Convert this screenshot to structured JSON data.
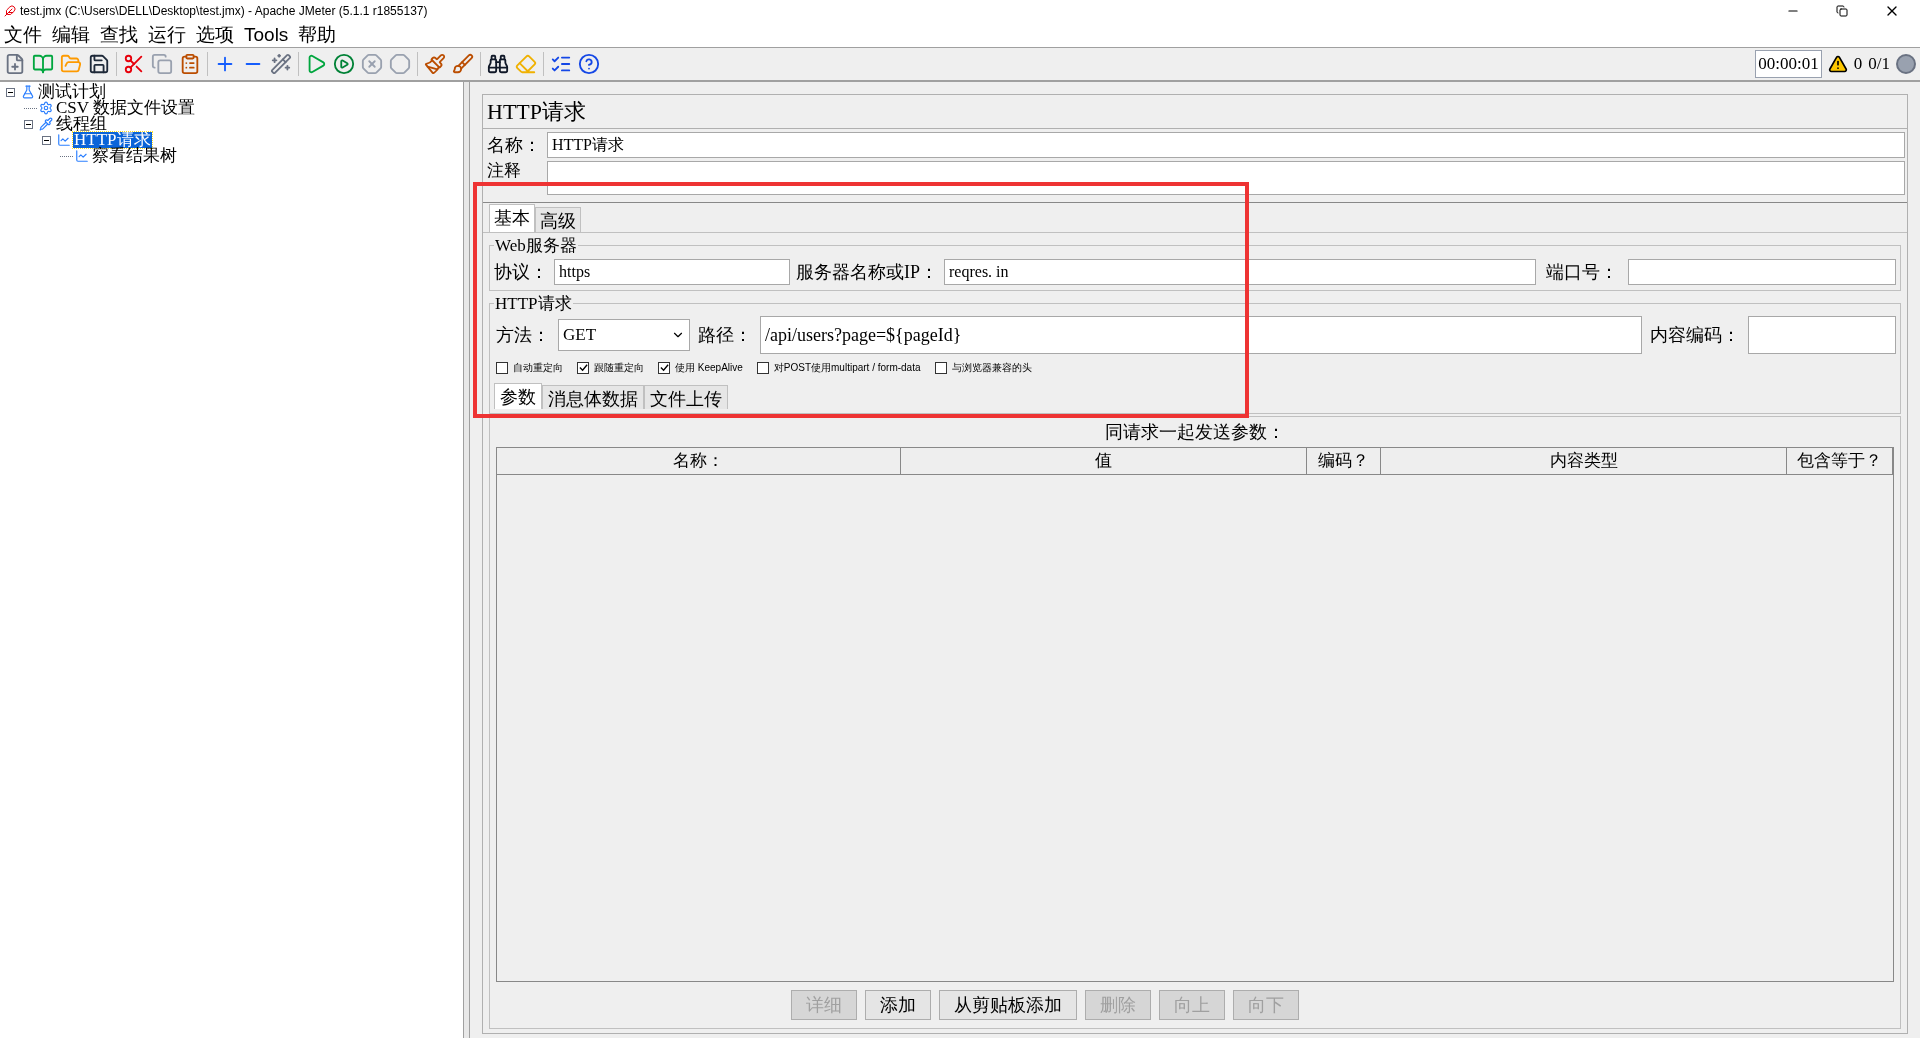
{
  "window": {
    "title": "test.jmx (C:\\Users\\DELL\\Desktop\\test.jmx) - Apache JMeter (5.1.1 r1855137)"
  },
  "menu": [
    "文件",
    "编辑",
    "查找",
    "运行",
    "选项",
    "Tools",
    "帮助"
  ],
  "status": {
    "timer": "00:00:01",
    "warnings": "0",
    "threads": "0/1"
  },
  "tree": [
    {
      "label": "测试计划",
      "selected": false,
      "expanded": true,
      "children": [
        {
          "label": "CSV 数据文件设置",
          "selected": false
        },
        {
          "label": "线程组",
          "selected": false,
          "expanded": true,
          "children": [
            {
              "label": "HTTP请求",
              "selected": true,
              "expanded": true,
              "children": [
                {
                  "label": "察看结果树",
                  "selected": false
                }
              ]
            }
          ]
        }
      ]
    }
  ],
  "panel": {
    "title": "HTTP请求",
    "name_label": "名称：",
    "name_value": "HTTP请求",
    "comment_label": "注释",
    "tabs": [
      {
        "label": "基本",
        "selected": true
      },
      {
        "label": "高级",
        "selected": false
      }
    ],
    "web_server": {
      "legend": "Web服务器",
      "protocol_label": "协议：",
      "protocol": "https",
      "server_label": "服务器名称或IP：",
      "server": "reqres. in",
      "port_label": "端口号："
    },
    "http_request": {
      "legend": "HTTP请求",
      "method_label": "方法：",
      "method": "GET",
      "path_label": "路径：",
      "path": "/api/users?page=${pageId}",
      "encoding_label": "内容编码："
    },
    "checkboxes": [
      {
        "label": "自动重定向",
        "checked": false
      },
      {
        "label": "跟随重定向",
        "checked": true
      },
      {
        "label": "使用 KeepAlive",
        "checked": true
      },
      {
        "label": "对POST使用multipart / form-data",
        "checked": false
      },
      {
        "label": "与浏览器兼容的头",
        "checked": false
      }
    ],
    "sub_tabs": [
      {
        "label": "参数",
        "selected": true
      },
      {
        "label": "消息体数据",
        "selected": false
      },
      {
        "label": "文件上传",
        "selected": false
      }
    ],
    "params": {
      "title": "同请求一起发送参数：",
      "columns": [
        "名称：",
        "值",
        "编码？",
        "内容类型",
        "包含等于？"
      ]
    },
    "buttons": [
      {
        "label": "详细",
        "disabled": true
      },
      {
        "label": "添加",
        "disabled": false
      },
      {
        "label": "从剪贴板添加",
        "disabled": false
      },
      {
        "label": "删除",
        "disabled": true
      },
      {
        "label": "向上",
        "disabled": true
      },
      {
        "label": "向下",
        "disabled": true
      }
    ]
  }
}
